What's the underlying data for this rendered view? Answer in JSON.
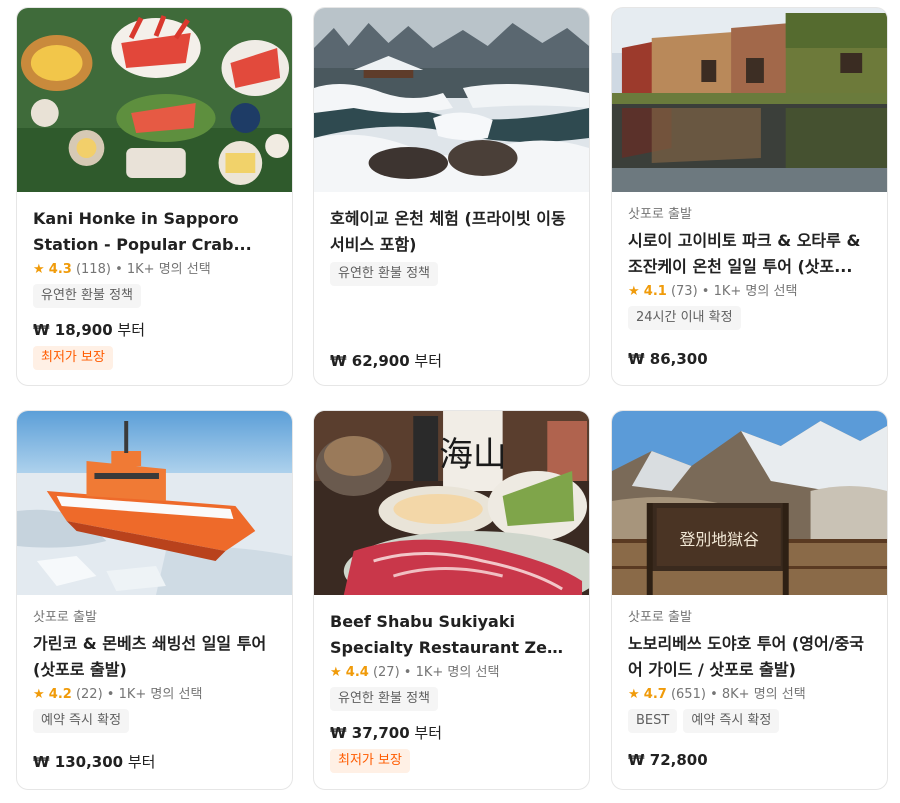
{
  "cards": [
    {
      "location": "",
      "title": "Kani Honke in Sapporo Station - Popular Crab...",
      "rating": {
        "score": "4.3",
        "reviews": "(118)",
        "booked": "1K+ 명의 선택"
      },
      "tags": [
        "유연한 환불 정책"
      ],
      "price": {
        "amount": "₩ 18,900",
        "suffix": " 부터"
      },
      "badge": "최저가 보장",
      "image_icon": "crab-food-image"
    },
    {
      "location": "",
      "title": "호헤이교 온천 체험 (프라이빗 이동 서비스 포함)",
      "rating": null,
      "tags": [
        "유연한 환불 정책"
      ],
      "price": {
        "amount": "₩ 62,900",
        "suffix": " 부터"
      },
      "badge": "",
      "image_icon": "snowy-onsen-image"
    },
    {
      "location": "삿포로 출발",
      "title": "시로이 고이비토 파크 & 오타루 & 조잔케이 온천 일일 투어 (삿포...",
      "rating": {
        "score": "4.1",
        "reviews": "(73)",
        "booked": "1K+ 명의 선택"
      },
      "tags": [
        "24시간 이내 확정"
      ],
      "price": {
        "amount": "₩ 86,300",
        "suffix": ""
      },
      "badge": "",
      "image_icon": "otaru-canal-image"
    },
    {
      "location": "삿포로 출발",
      "title": "가린코 & 몬베츠 쇄빙선 일일 투어 (삿포로 출발)",
      "rating": {
        "score": "4.2",
        "reviews": "(22)",
        "booked": "1K+ 명의 선택"
      },
      "tags": [
        "예약 즉시 확정"
      ],
      "price": {
        "amount": "₩ 130,300",
        "suffix": " 부터"
      },
      "badge": "",
      "image_icon": "icebreaker-ship-image"
    },
    {
      "location": "",
      "title": "Beef Shabu Sukiyaki Specialty Restaurant Zen (...",
      "rating": {
        "score": "4.4",
        "reviews": "(27)",
        "booked": "1K+ 명의 선택"
      },
      "tags": [
        "유연한 환불 정책"
      ],
      "price": {
        "amount": "₩ 37,700",
        "suffix": " 부터"
      },
      "badge": "최저가 보장",
      "image_icon": "beef-shabu-image"
    },
    {
      "location": "삿포로 출발",
      "title": "노보리베쓰 도야호 투어 (영어/중국어 가이드 / 삿포로 출발)",
      "rating": {
        "score": "4.7",
        "reviews": "(651)",
        "booked": "8K+ 명의 선택"
      },
      "tags": [
        "BEST",
        "예약 즉시 확정"
      ],
      "price": {
        "amount": "₩ 72,800",
        "suffix": ""
      },
      "badge": "",
      "image_icon": "hell-valley-image"
    }
  ],
  "image_text": {
    "sake_label": "海山",
    "hell_valley_sign": "登別地獄谷"
  }
}
